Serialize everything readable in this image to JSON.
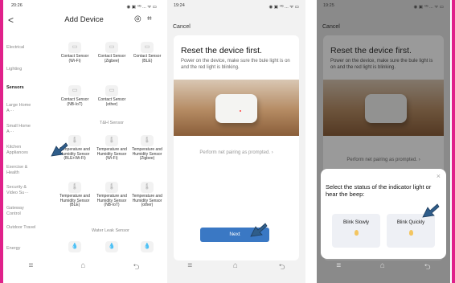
{
  "phone1": {
    "status": {
      "time": "20:26",
      "icons": "◉ ▣ ⁴ᴳ ... ᯤ ▭"
    },
    "header": {
      "back": "<",
      "title": "Add Device",
      "icon_a": "◎",
      "icon_b": "⌗"
    },
    "categories": [
      "Electrical",
      "Lighting",
      "Sensors",
      "Large Home A···",
      "Small Home A···",
      "Kitchen Appliances",
      "Exercise & Health",
      "Security & Video Su···",
      "Gateway Control",
      "Outdoor Travel",
      "Energy"
    ],
    "row1": [
      "Contact Sensor (Wi-Fi)",
      "Contact Sensor (Zigbee)",
      "Contact Sensor (BLE)"
    ],
    "row2": [
      "Contact Sensor (NB-IoT)",
      "Contact Sensor (other)"
    ],
    "th_section": "T&H Sensor",
    "row3": [
      "Temperature and Humidity Sensor (BLE+Wi-Fi)",
      "Temperature and Humidity Sensor (Wi-Fi)",
      "Temperature and Humidity Sensor (Zigbee)"
    ],
    "row4": [
      "Temperature and Humidity Sensor (BLE)",
      "Temperature and Humidity Sensor (NB-IoT)",
      "Temperature and Humidity Sensor (other)"
    ],
    "wl_section": "Water Leak Sensor",
    "nav": [
      "≡",
      "⌂",
      "⮌"
    ]
  },
  "phone2": {
    "status": {
      "time": "19:24",
      "icons": "◉ ▣ ⁴ᴳ ... ᯤ ▭"
    },
    "cancel": "Cancel",
    "title": "Reset the device first.",
    "desc": "Power on the device, make sure the bule light is on and the red light is blinking.",
    "perform": "Perform net pairing as prompted. ›",
    "next": "Next",
    "nav": [
      "≡",
      "⌂",
      "⮌"
    ]
  },
  "phone3": {
    "status": {
      "time": "19:25",
      "icons": "◉ ▣ ⁴ᴳ ... ᯤ ▭"
    },
    "cancel": "Cancel",
    "title": "Reset the device first.",
    "desc": "Power on the device, make sure the bule light is on and the red light is blinking.",
    "perform": "Perform net pairing as prompted. ›",
    "sheet_close": "×",
    "question": "Select the status of the indicator light or hear the beep:",
    "option_slow": "Blink Slowly",
    "option_quick": "Blink Quickly",
    "nav": [
      "≡",
      "⌂",
      "⮌"
    ]
  },
  "colors": {
    "frame": "#e0218a",
    "accent": "#3a78c4",
    "arrow": "#2f5d8a"
  }
}
